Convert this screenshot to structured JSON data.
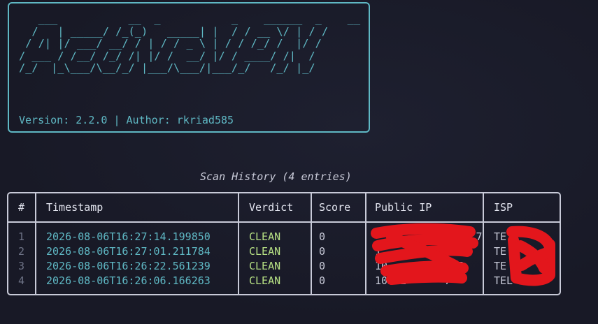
{
  "banner": {
    "ascii_lines": [
      "   ___           __  _           _    ______  _    __",
      "  /   | _____/ /_(_)   _____| |  / / __ \\/ | / /",
      " / /| |/ ___/ __/ / | / / _ \\ | / / /_/ /  |/ /",
      "/ ___ / /__/ /_/ /| |/ /  __/ |/ / ____/ /|  /",
      "/_/  |_\\___/\\__/_/ |___/\\___/|___/_/   /_/ |_/"
    ],
    "version_text": "Version: 2.2.0 | Author: rkriad585"
  },
  "history": {
    "title": "Scan History (4 entries)",
    "columns": [
      "#",
      "Timestamp",
      "Verdict",
      "Score",
      "Public IP",
      "ISP"
    ],
    "rows": [
      {
        "idx": "1",
        "timestamp": "2026-08-06T16:27:14.199850",
        "verdict": "CLEAN",
        "score": "0",
        "ip": "      .     .   7",
        "isp": "TE    "
      },
      {
        "idx": "2",
        "timestamp": "2026-08-06T16:27:01.211784",
        "verdict": "CLEAN",
        "score": "0",
        "ip": "1    .279.106.",
        "isp": "TE    "
      },
      {
        "idx": "3",
        "timestamp": "2026-08-06T16:26:22.561239",
        "verdict": "CLEAN",
        "score": "0",
        "ip": "10        .147",
        "isp": "TE    "
      },
      {
        "idx": "4",
        "timestamp": "2026-08-06T16:26:06.166263",
        "verdict": "CLEAN",
        "score": "0",
        "ip": "103.2      7",
        "isp": "TEL   "
      }
    ]
  },
  "colors": {
    "accent": "#5fb8c4",
    "verdict_clean": "#b6e084",
    "redaction": "#e3161c"
  }
}
